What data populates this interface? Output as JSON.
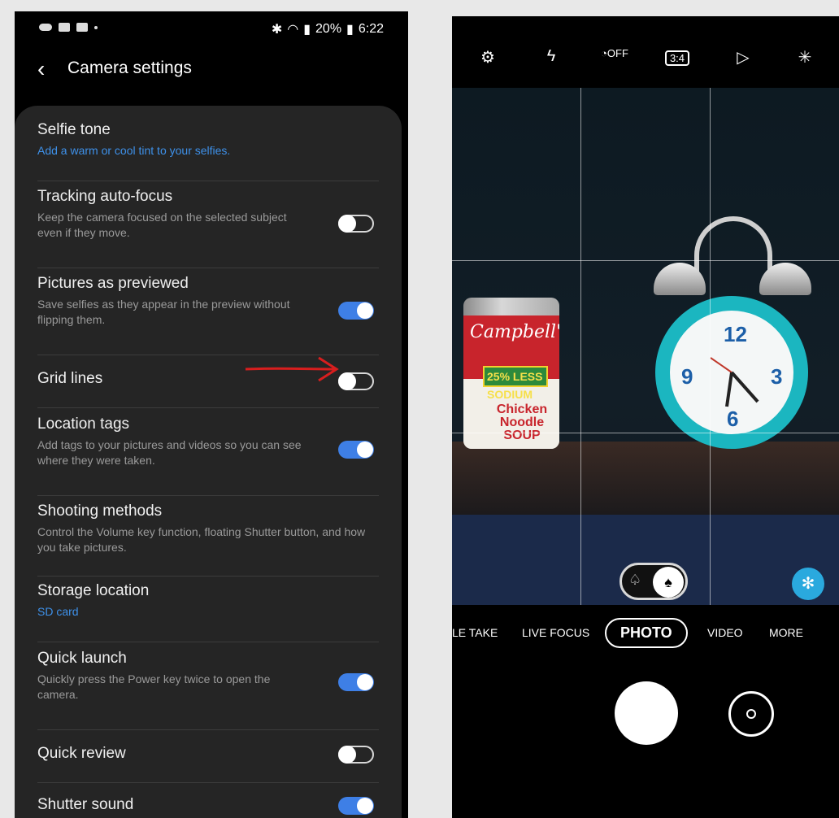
{
  "status_bar": {
    "battery": "20%",
    "time": "6:22"
  },
  "settings": {
    "title": "Camera settings",
    "items": [
      {
        "title": "Selfie tone",
        "desc": "Add a warm or cool tint to your selfies.",
        "desc_color": "blue",
        "toggle": null
      },
      {
        "title": "Tracking auto-focus",
        "desc": "Keep the camera focused on the selected subject even if they move.",
        "toggle": "off"
      },
      {
        "title": "Pictures as previewed",
        "desc": "Save selfies as they appear in the preview without flipping them.",
        "toggle": "on"
      },
      {
        "title": "Grid lines",
        "desc": "",
        "toggle": "off"
      },
      {
        "title": "Location tags",
        "desc": "Add tags to your pictures and videos so you can see where they were taken.",
        "toggle": "on"
      },
      {
        "title": "Shooting methods",
        "desc": "Control the Volume key function, floating Shutter button, and how you take pictures.",
        "toggle": null
      },
      {
        "title": "Storage location",
        "desc": "SD card",
        "desc_color": "blue",
        "toggle": null
      },
      {
        "title": "Quick launch",
        "desc": "Quickly press the Power key twice to open the camera.",
        "toggle": "on"
      },
      {
        "title": "Quick review",
        "desc": "",
        "toggle": "off"
      },
      {
        "title": "Shutter sound",
        "desc": "",
        "toggle": "on"
      }
    ]
  },
  "camera": {
    "top_icons": [
      "settings-icon",
      "flash-off-icon",
      "timer-off-icon",
      "aspect-ratio-icon",
      "motion-photo-icon",
      "filter-icon"
    ],
    "aspect_label": "3:4",
    "timer_label": "OFF",
    "modes": [
      "LE TAKE",
      "LIVE FOCUS",
      "PHOTO",
      "VIDEO",
      "MORE"
    ],
    "active_mode": "PHOTO",
    "scene": {
      "can_brand": "Campbell's",
      "can_badge": "25% LESS SODIUM",
      "can_label": "Chicken Noodle SOUP"
    }
  },
  "colors": {
    "accent": "#3e7fe6",
    "link_blue": "#3e91ea",
    "panel": "#252525",
    "annotation_arrow": "#d81e1e"
  }
}
